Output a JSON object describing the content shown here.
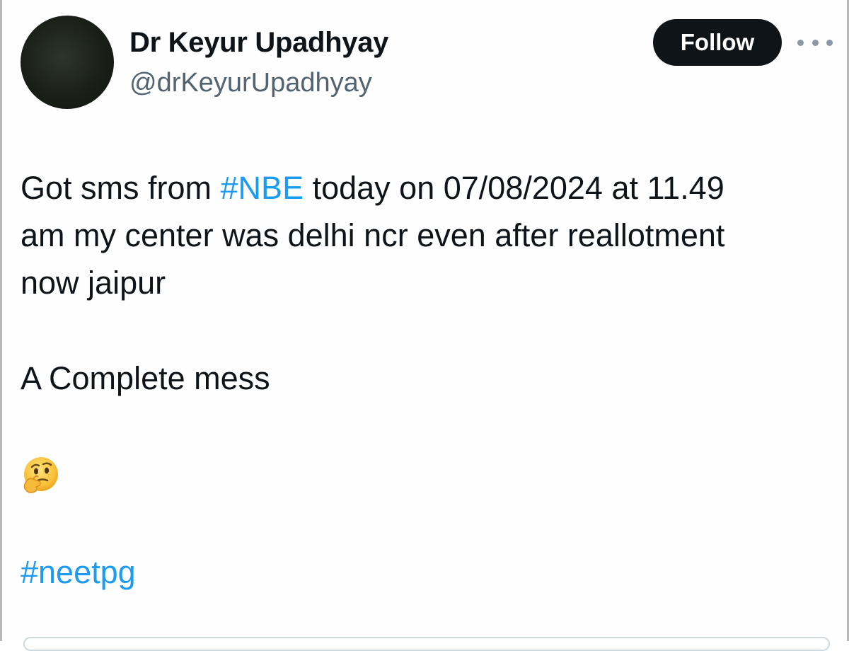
{
  "tweet": {
    "author": {
      "display_name": "Dr Keyur Upadhyay",
      "handle": "@drKeyurUpadhyay",
      "avatar_color": "#1a2018"
    },
    "follow_label": "Follow",
    "more_icon": "more-horizontal-icon",
    "text": {
      "line1_pre": "Got sms from ",
      "line1_hashtag": "#NBE",
      "line1_post": " today on 07/08/2024 at 11.49",
      "line2": "am  my center was delhi ncr even after reallotment",
      "line3": "now jaipur",
      "line4": "A Complete mess",
      "emoji": "thinking-face-icon",
      "hashtag2": "#neetpg"
    },
    "colors": {
      "text": "#0f1419",
      "secondary": "#536471",
      "link": "#1d9bf0",
      "button_bg": "#0f1419"
    }
  }
}
